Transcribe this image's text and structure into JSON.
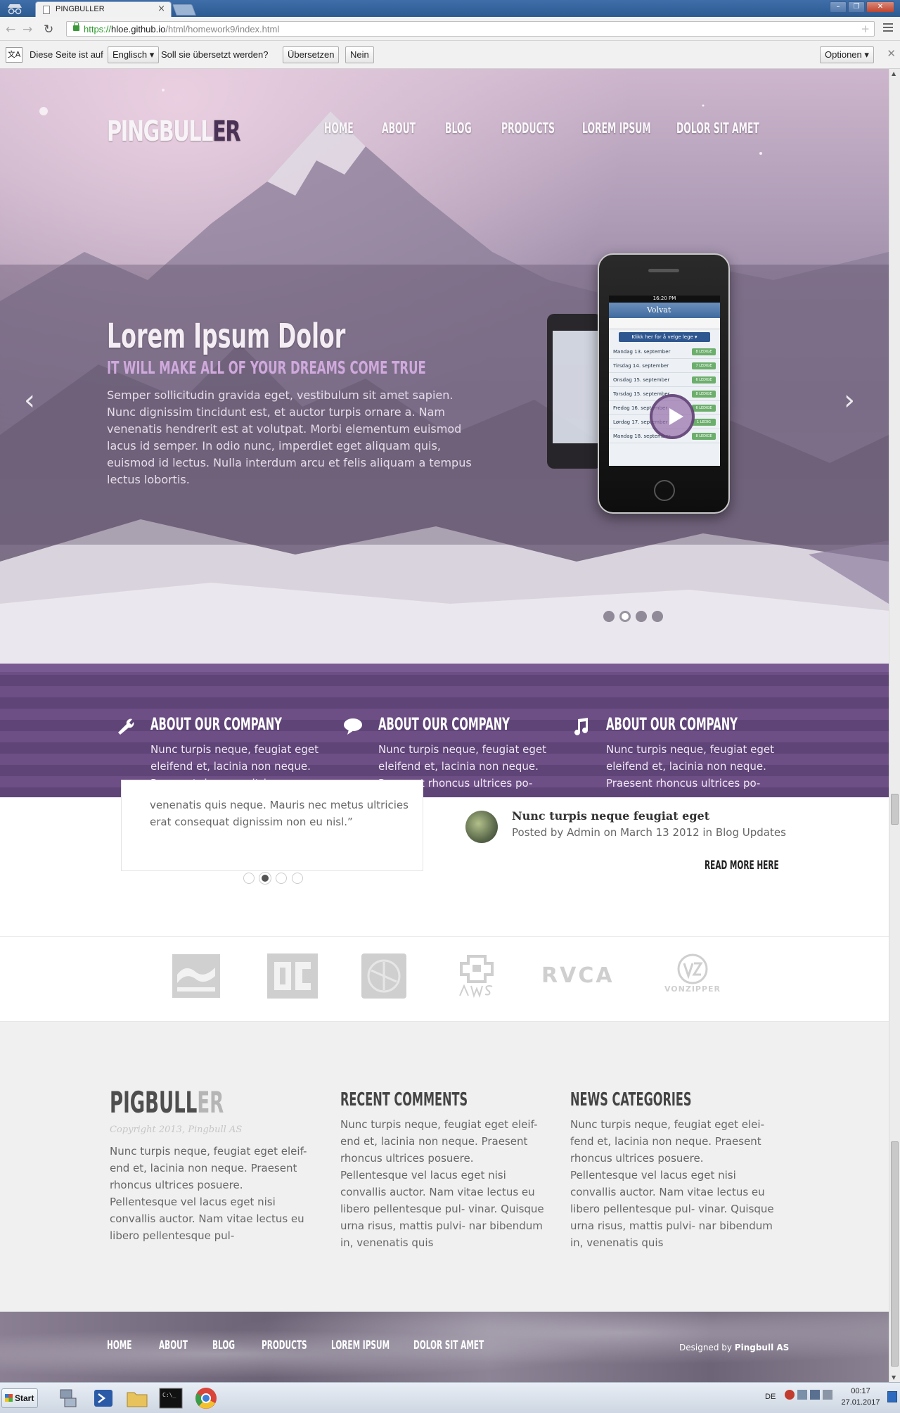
{
  "browser": {
    "tab_title": "PINGBULLER",
    "url_scheme": "https://",
    "url_host": "hloe.github.io",
    "url_path": "/html/homework9/index.html",
    "translate_bar": {
      "prefix": "Diese Seite ist auf",
      "language": "Englisch",
      "question": "Soll sie übersetzt werden?",
      "translate_button": "Übersetzen",
      "no_button": "Nein",
      "options_button": "Optionen"
    }
  },
  "site": {
    "logo_main": "PINGBULL",
    "logo_accent": "ER",
    "nav": [
      "HOME",
      "ABOUT",
      "BLOG",
      "PRODUCTS",
      "LOREM IPSUM",
      "DOLOR SIT AMET"
    ],
    "hero": {
      "title": "Lorem Ipsum Dolor",
      "subtitle": "IT WILL MAKE ALL OF YOUR DREAMS COME TRUE",
      "text": "Semper sollicitudin gravida eget, vestibulum sit amet sapien. Nunc dignissim tincidunt est, et auctor turpis ornare a. Nam venenatis hendrerit est at volutpat. Morbi elementum euismod lacus id semper. In odio nunc, imperdiet eget aliquam quis, euismod id lectus. Nulla interdum arcu et felis aliquam a tempus lectus lobortis.",
      "slide_count": 4,
      "active_slide": 2,
      "phone": {
        "time": "16:20 PM",
        "logo": "Volvat",
        "cta": "Klikk her for å velge lege ▾",
        "rows": [
          {
            "day": "Mandag 13. september",
            "badge": "8 LEDIGE"
          },
          {
            "day": "Tirsdag 14. september",
            "badge": "7 LEDIGE"
          },
          {
            "day": "Onsdag 15. september",
            "badge": "6 LEDIGE"
          },
          {
            "day": "Torsdag 15. september",
            "badge": "8 LEDIGE"
          },
          {
            "day": "Fredag 16. september",
            "badge": "6 LEDIGE"
          },
          {
            "day": "Lørdag 17. september",
            "badge": "1 LEDIG"
          },
          {
            "day": "Mandag 18. september",
            "badge": "8 LEDIGE"
          }
        ]
      }
    },
    "features": [
      {
        "icon": "wrench-icon",
        "title": "ABOUT OUR COMPANY",
        "text": "Nunc turpis neque, feugiat eget eleifend et, lacinia non neque. Praesent rhoncus ultrices po-"
      },
      {
        "icon": "speech-bubble-icon",
        "title": "ABOUT OUR COMPANY",
        "text": "Nunc turpis neque, feugiat eget eleifend et, lacinia non neque. Praesent rhoncus ultrices po-"
      },
      {
        "icon": "music-note-icon",
        "title": "ABOUT OUR COMPANY",
        "text": "Nunc turpis neque, feugiat eget eleifend et, lacinia non neque. Praesent rhoncus ultrices po-"
      }
    ],
    "testimonial": {
      "text": "venenatis quis neque. Mauris nec metus ultricies erat consequat dignissim non eu nisl.”",
      "dot_count": 4,
      "active_dot": 2
    },
    "blog": {
      "post_title": "Nunc turpis neque feugiat eget",
      "post_meta": "Posted by Admin on March 13 2012 in Blog Updates",
      "read_more": "READ MORE HERE"
    },
    "brands": [
      "billabong-logo",
      "dc-logo",
      "element-logo",
      "awsm-logo",
      "RVCA",
      "VONZIPPER"
    ],
    "footer": {
      "logo_main": "PIGBULL",
      "logo_accent": "ER",
      "copyright": "Copyright 2013, Pingbull AS",
      "about_text": "Nunc turpis neque, feugiat eget eleif- end et, lacinia non neque. Praesent rhoncus ultrices posuere. Pellentesque vel lacus eget nisi convallis auctor. Nam vitae lectus eu libero pellentesque pul-",
      "col2_title": "RECENT COMMENTS",
      "col2_text": "Nunc turpis neque, feugiat eget eleif- end et, lacinia non neque. Praesent rhoncus ultrices posuere. Pellentesque vel lacus eget nisi convallis auctor. Nam vitae lectus eu libero pellentesque pul- vinar. Quisque urna risus, mattis pulvi- nar bibendum in, venenatis quis",
      "col3_title": "NEWS CATEGORIES",
      "col3_text": "Nunc turpis neque, feugiat eget elei- fend et, lacinia non neque. Praesent rhoncus ultrices posuere. Pellentesque vel lacus eget nisi convallis auctor. Nam vitae lectus eu libero pellentesque pul- vinar. Quisque urna risus, mattis pulvi- nar bibendum in, venenatis quis",
      "nav": [
        "HOME",
        "ABOUT",
        "BLOG",
        "PRODUCTS",
        "LOREM IPSUM",
        "DOLOR SIT AMET"
      ],
      "designed_prefix": "Designed by",
      "designed_by": "Pingbull AS"
    }
  },
  "taskbar": {
    "start": "Start",
    "apps": [
      "network-app-icon",
      "powershell-icon",
      "file-explorer-icon",
      "command-prompt-icon",
      "chrome-icon"
    ],
    "language": "DE",
    "time": "00:17",
    "date": "27.01.2017"
  },
  "colors": {
    "brand_purple": "#6d4f85",
    "accent_dark": "#4a3256",
    "subtitle_purple": "#cfa9dc"
  }
}
